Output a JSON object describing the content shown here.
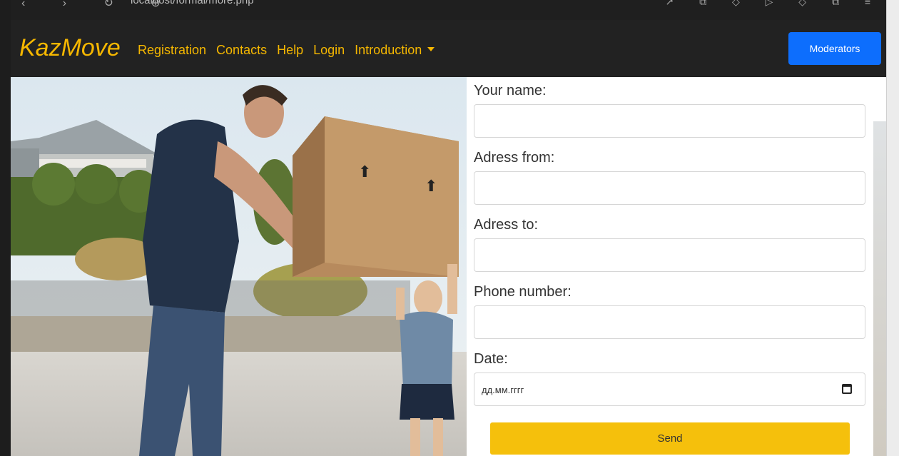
{
  "browser": {
    "nav_glyphs": "‹ › ↻ ⊕",
    "url": "localhost/formal/more.php",
    "right_glyphs": "↗ ⧉ ◇ ▷ ◇ ⧉ ≡"
  },
  "navbar": {
    "brand": "KazMove",
    "links": [
      "Registration",
      "Contacts",
      "Help",
      "Login",
      "Introduction"
    ],
    "moderators_label": "Moderators",
    "accent_color": "#f5b700",
    "button_color": "#0d6efd"
  },
  "form": {
    "name_label": "Your name:",
    "from_label": "Adress from:",
    "to_label": "Adress to:",
    "phone_label": "Phone number:",
    "date_label": "Date:",
    "date_placeholder": "дд.мм.гггг",
    "send_label": "Send",
    "send_color": "#f5c00c"
  },
  "photo": {
    "description_icon": "family-moving-box-photo"
  }
}
